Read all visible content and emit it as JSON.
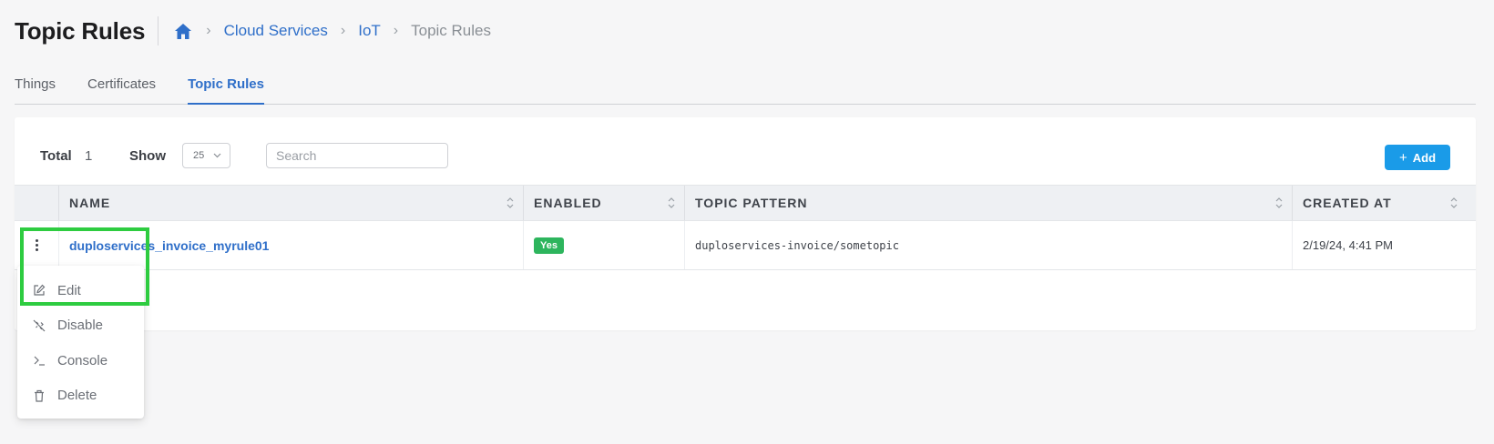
{
  "header": {
    "title": "Topic Rules",
    "breadcrumb": {
      "home_icon": "home-icon",
      "items": [
        "Cloud Services",
        "IoT"
      ],
      "current": "Topic Rules"
    }
  },
  "tabs": [
    {
      "label": "Things",
      "active": false
    },
    {
      "label": "Certificates",
      "active": false
    },
    {
      "label": "Topic Rules",
      "active": true
    }
  ],
  "toolbar": {
    "total_label": "Total",
    "total_value": "1",
    "show_label": "Show",
    "show_value": "25",
    "search_placeholder": "Search",
    "add_label": "Add"
  },
  "table": {
    "columns": [
      "NAME",
      "ENABLED",
      "TOPIC PATTERN",
      "CREATED AT"
    ],
    "rows": [
      {
        "name": "duploservices_invoice_myrule01",
        "enabled": "Yes",
        "topic_pattern": "duploservices-invoice/sometopic",
        "created_at": "2/19/24, 4:41 PM"
      }
    ]
  },
  "context_menu": {
    "items": [
      {
        "label": "Edit",
        "icon": "edit-icon"
      },
      {
        "label": "Disable",
        "icon": "disable-icon"
      },
      {
        "label": "Console",
        "icon": "console-icon"
      },
      {
        "label": "Delete",
        "icon": "trash-icon"
      }
    ]
  },
  "colors": {
    "accent": "#2f6fc9",
    "add_button": "#1a9be8",
    "enabled_badge": "#2db55d",
    "highlight": "#2ecc40"
  }
}
